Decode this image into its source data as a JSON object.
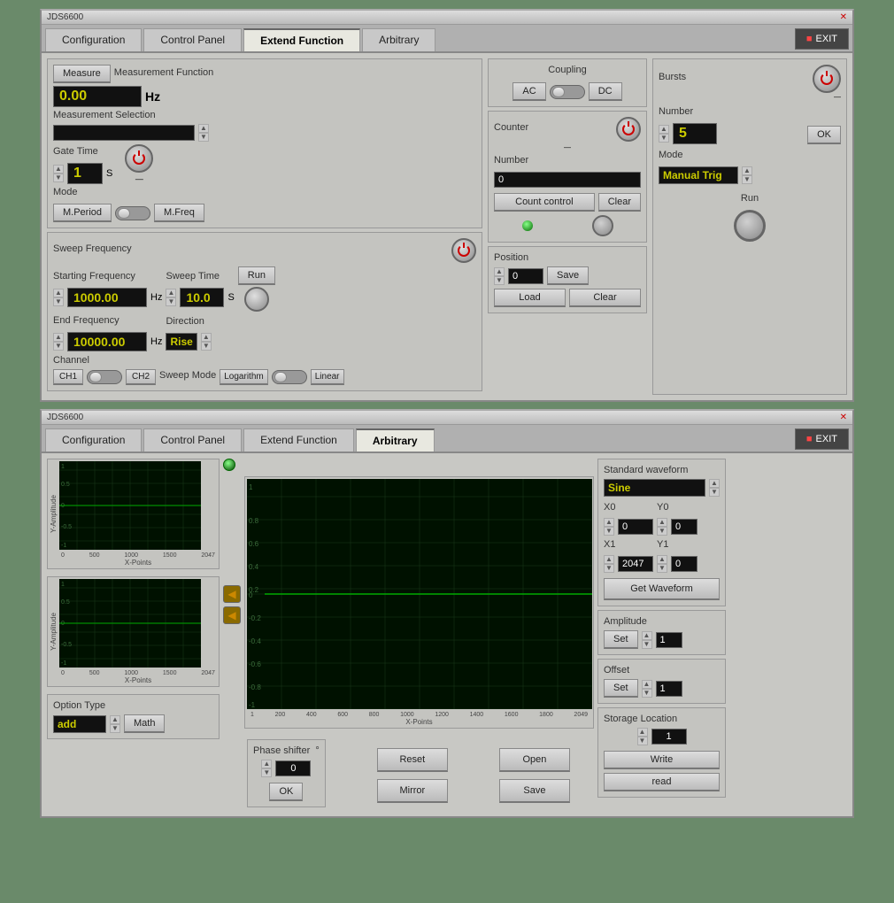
{
  "windows": [
    {
      "id": "top",
      "title": "JDS6600",
      "tabs": [
        "Configuration",
        "Control Panel",
        "Extend Function",
        "Arbitrary"
      ],
      "active_tab": "Extend Function",
      "exit_label": "EXIT",
      "measurement": {
        "label": "Measure",
        "function_label": "Measurement Function",
        "value": "0.00",
        "unit": "Hz",
        "selection_label": "Measurement Selection",
        "gate_time_label": "Gate Time",
        "gate_time_value": "1",
        "gate_unit": "S",
        "mode_label": "Mode",
        "m_period": "M.Period",
        "m_freq": "M.Freq"
      },
      "sweep": {
        "label": "Sweep Frequency",
        "start_freq_label": "Starting Frequency",
        "start_freq_value": "1000.00",
        "start_unit": "Hz",
        "sweep_time_label": "Sweep Time",
        "sweep_time_value": "10.0",
        "sweep_unit": "S",
        "run_label": "Run",
        "end_freq_label": "End Frequency",
        "end_freq_value": "10000.00",
        "end_unit": "Hz",
        "direction_label": "Direction",
        "direction_value": "Rise",
        "channel_label": "Channel",
        "ch1": "CH1",
        "ch2": "CH2",
        "sweep_mode_label": "Sweep Mode",
        "logarithm": "Logarithm",
        "linear": "Linear"
      },
      "coupling": {
        "label": "Coupling",
        "ac": "AC",
        "dc": "DC"
      },
      "counter": {
        "label": "Counter",
        "number_label": "Number",
        "number_value": "0",
        "count_control": "Count control",
        "clear": "Clear"
      },
      "bursts": {
        "label": "Bursts",
        "number_label": "Number",
        "number_value": "5",
        "ok": "OK",
        "mode_label": "Mode",
        "mode_value": "Manual Trig",
        "run": "Run"
      },
      "position": {
        "label": "Position",
        "value": "0",
        "save": "Save",
        "load": "Load",
        "clear": "Clear"
      }
    },
    {
      "id": "bottom",
      "title": "JDS6600",
      "tabs": [
        "Configuration",
        "Control Panel",
        "Extend Function",
        "Arbitrary"
      ],
      "active_tab": "Arbitrary",
      "exit_label": "EXIT",
      "small_charts": {
        "chart1_x_label": "X-Points",
        "chart1_y_label": "Y-Amplitude",
        "chart1_x_max": "2047",
        "chart2_x_label": "X-Points",
        "chart2_y_label": "Y-Amplitude",
        "chart2_x_max": "2047"
      },
      "main_chart": {
        "x_label": "X-Points",
        "y_label": "Y-Amplitude",
        "x_max": "2049"
      },
      "standard_waveform": {
        "label": "Standard waveform",
        "value": "Sine",
        "x0_label": "X0",
        "x0_value": "0",
        "y0_label": "Y0",
        "y0_value": "0",
        "x1_label": "X1",
        "x1_value": "2047",
        "y1_label": "Y1",
        "y1_value": "0",
        "get_waveform": "Get Waveform",
        "amplitude_label": "Amplitude",
        "set": "Set",
        "amplitude_value": "1",
        "offset_label": "Offset",
        "offset_set": "Set",
        "offset_value": "1",
        "storage_label": "Storage Location",
        "storage_value": "1",
        "write": "Write",
        "read": "read"
      },
      "option_type": {
        "label": "Option Type",
        "value": "add",
        "math_btn": "Math"
      },
      "phase_shifter": {
        "label": "Phase shifter",
        "unit": "°",
        "value": "0",
        "ok": "OK"
      },
      "actions": {
        "reset": "Reset",
        "mirror": "Mirror",
        "open": "Open",
        "save": "Save"
      }
    }
  ]
}
